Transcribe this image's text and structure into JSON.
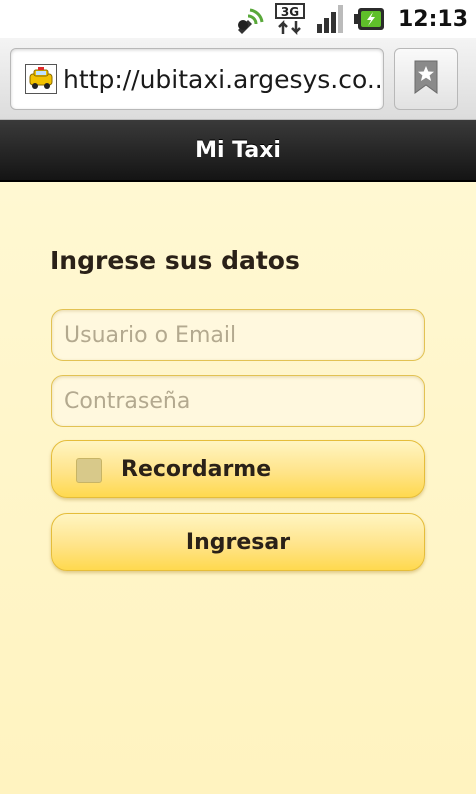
{
  "status_bar": {
    "time": "12:13",
    "icons": [
      "sync-signal-icon",
      "3g-data-icon",
      "signal-strength-icon",
      "battery-charging-icon"
    ],
    "network_label": "3G"
  },
  "browser": {
    "url": "http://ubitaxi.argesys.co...",
    "favicon": "taxi-favicon-icon",
    "bookmark_icon": "bookmark-star-icon"
  },
  "header": {
    "title": "Mi Taxi"
  },
  "login_form": {
    "heading": "Ingrese sus datos",
    "username_placeholder": "Usuario o Email",
    "username_value": "",
    "password_placeholder": "Contraseña",
    "password_value": "",
    "remember_label": "Recordarme",
    "remember_checked": false,
    "submit_label": "Ingresar"
  },
  "colors": {
    "accent_yellow": "#ffe48a",
    "background": "#fff7cf",
    "header_dark": "#1e1e1e"
  }
}
